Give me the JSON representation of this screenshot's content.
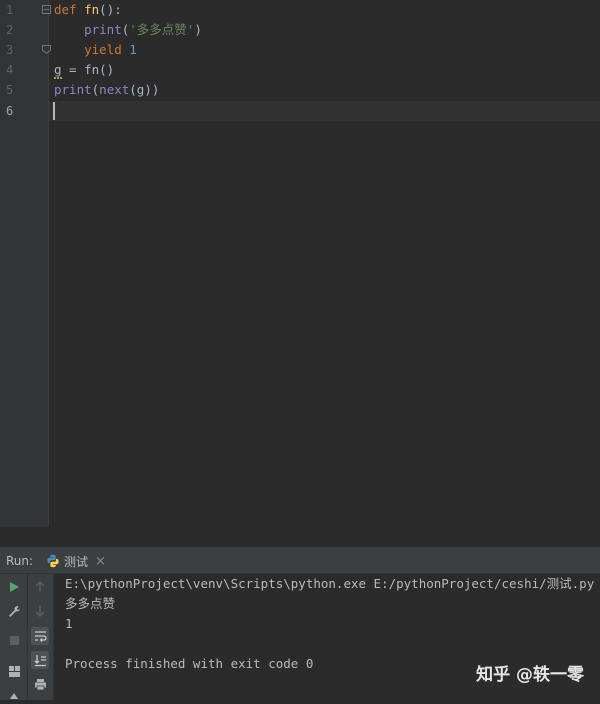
{
  "editor": {
    "line_numbers": [
      "1",
      "2",
      "3",
      "4",
      "5",
      "6"
    ],
    "code": {
      "l1_kw": "def ",
      "l1_name": "fn",
      "l1_rest": "():",
      "l2_indent": "    ",
      "l2_builtin": "print",
      "l2_open": "(",
      "l2_str": "'多多点赞'",
      "l2_close": ")",
      "l3_indent": "    ",
      "l3_kw": "yield ",
      "l3_num": "1",
      "l4_var": "g",
      "l4_rest": " = fn()",
      "l5_builtin1": "print",
      "l5_mid": "(",
      "l5_builtin2": "next",
      "l5_end": "(g))"
    }
  },
  "run": {
    "label": "Run:",
    "tab_title": "测试",
    "tab_close": "×",
    "console_lines": [
      "E:\\pythonProject\\venv\\Scripts\\python.exe E:/pythonProject/ceshi/测试.py",
      "多多点赞",
      "1",
      "",
      "Process finished with exit code 0"
    ]
  },
  "watermark": "知乎 @轶一零",
  "colors": {
    "editor_bg": "#2b2b2b",
    "keyword": "#cc7832",
    "function_name": "#ffc66d",
    "builtin": "#8888c6",
    "string": "#6a8759",
    "number": "#6897bb",
    "run_green": "#59a869"
  }
}
